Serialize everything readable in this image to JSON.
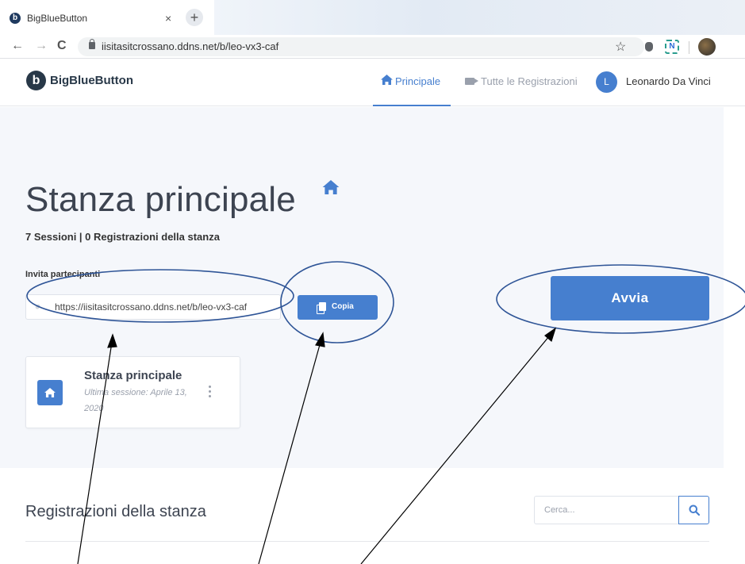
{
  "browser": {
    "tab_title": "BigBlueButton",
    "favicon": "b",
    "tab_close": "×",
    "new_tab": "+",
    "back": "←",
    "forward": "→",
    "reload": "C",
    "url": "iisitasitcrossano.ddns.net/b/leo-vx3-caf",
    "star": "☆",
    "extension_label": "N"
  },
  "header": {
    "logo_mark": "b",
    "logo_text": "BigBlueButton",
    "nav": {
      "home": "Principale",
      "recordings": "Tutte le Registrazioni"
    },
    "user": {
      "initial": "L",
      "name": "Leonardo Da Vinci"
    }
  },
  "room": {
    "title": "Stanza principale",
    "stats": "7 Sessioni | 0 Registrazioni della stanza",
    "invite_label": "Invita partecipanti",
    "invite_url": "https://iisitasitcrossano.ddns.net/b/leo-vx3-caf",
    "copy_label": "Copia",
    "start_label": "Avvia",
    "card": {
      "title": "Stanza principale",
      "subtitle": "Ultima sessione: Aprile 13, 2020"
    }
  },
  "recordings": {
    "title": "Registrazioni della stanza",
    "search_placeholder": "Cerca..."
  },
  "colors": {
    "accent": "#467fcf",
    "annotation": "#2f5597"
  }
}
